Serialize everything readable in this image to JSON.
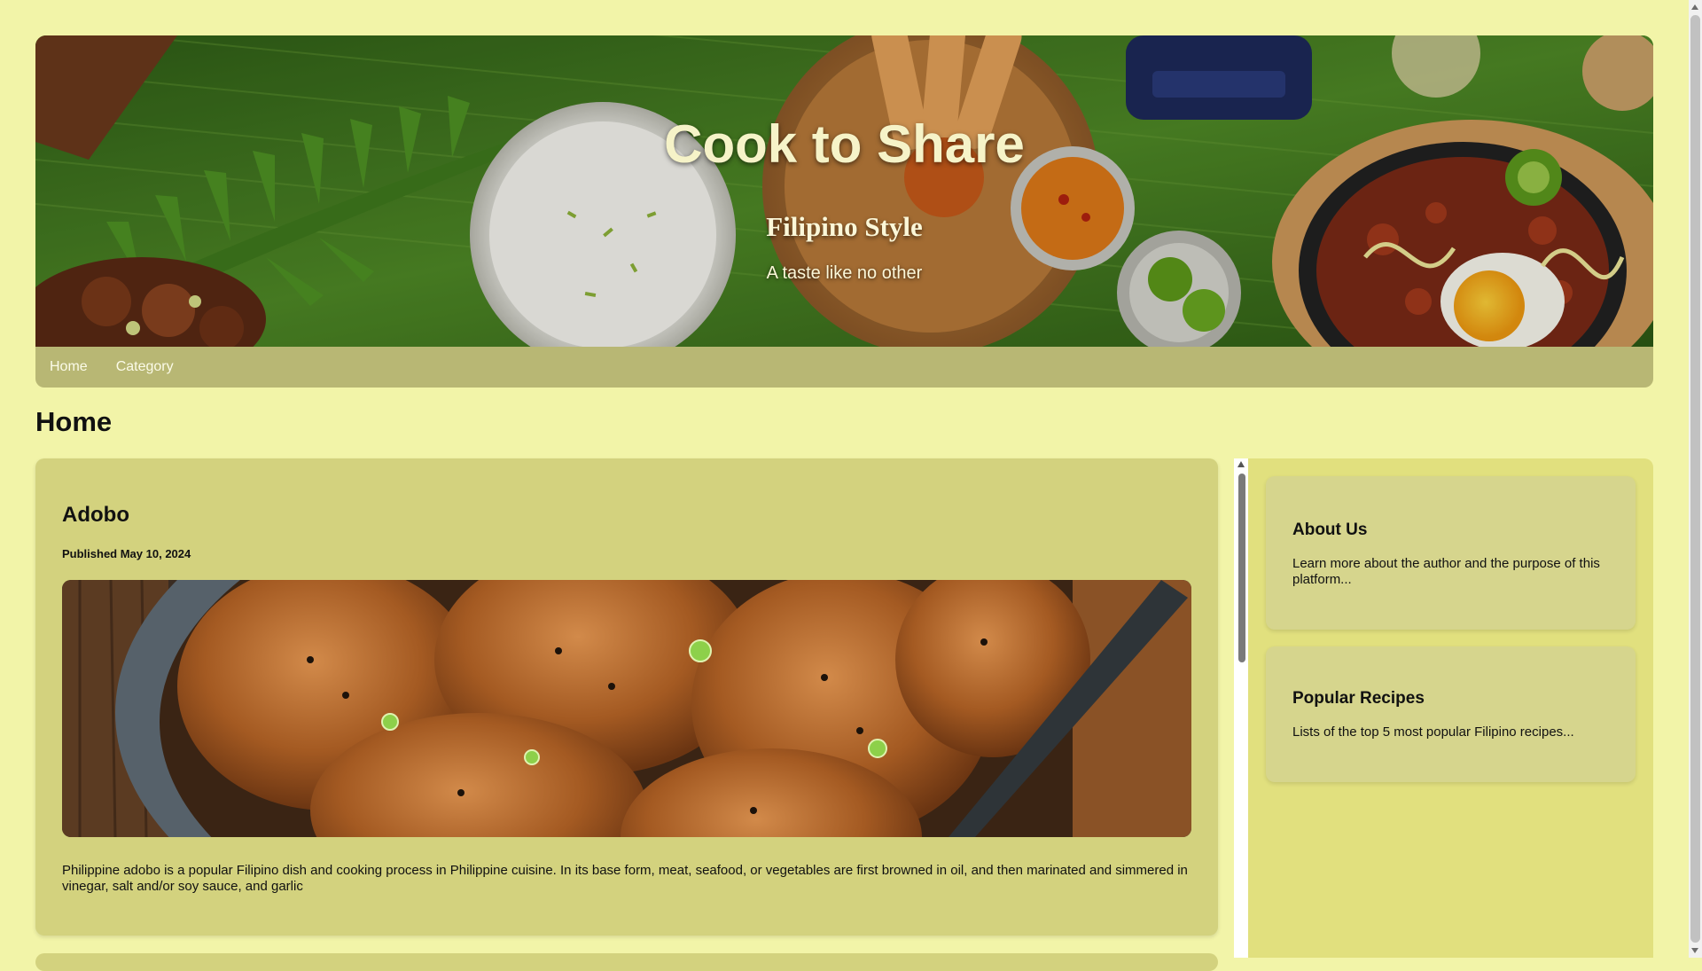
{
  "site": {
    "title": "Cook to Share",
    "subtitle": "Filipino Style",
    "tagline": "A taste like no other"
  },
  "nav": {
    "items": [
      {
        "label": "Home"
      },
      {
        "label": "Category"
      }
    ]
  },
  "page": {
    "heading": "Home"
  },
  "post": {
    "title": "Adobo",
    "published": "Published May 10, 2024",
    "image_icon": "adobo-dish-image",
    "excerpt": "Philippine adobo is a popular Filipino dish and cooking process in Philippine cuisine. In its base form, meat, seafood, or vegetables are first browned in oil, and then marinated and simmered in vinegar, salt and/or soy sauce, and garlic"
  },
  "sidebar": {
    "widgets": [
      {
        "title": "About Us",
        "text": "Learn more about the author and the purpose of this platform..."
      },
      {
        "title": "Popular Recipes",
        "text": "Lists of the top 5 most popular Filipino recipes..."
      }
    ]
  },
  "colors": {
    "page_bg": "#f2f4a8",
    "nav_bg": "#b8b774",
    "card_bg": "#d3d27e",
    "sidebar_bg": "#e1e07e",
    "widget_bg": "#d6d58d"
  }
}
